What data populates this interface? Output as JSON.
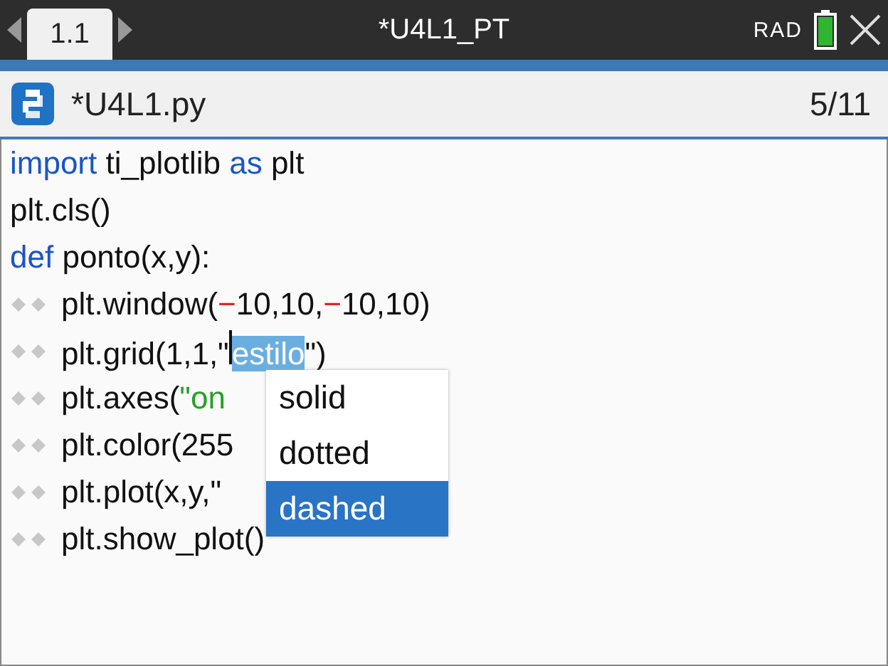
{
  "top_bar": {
    "tab": {
      "label": "1.1",
      "selected": true
    },
    "title": "*U4L1_PT",
    "angle_mode": "RAD"
  },
  "editor": {
    "file_name": "*U4L1.py",
    "position": "5/11",
    "lines": [
      {
        "tokens": [
          {
            "kind": "keyword",
            "text": "import"
          },
          {
            "kind": "plain",
            "text": " ti_plotlib "
          },
          {
            "kind": "keyword",
            "text": "as"
          },
          {
            "kind": "plain",
            "text": " plt"
          }
        ]
      },
      {
        "tokens": [
          {
            "kind": "plain",
            "text": "plt.cls()"
          }
        ]
      },
      {
        "tokens": [
          {
            "kind": "keyword",
            "text": "def"
          },
          {
            "kind": "plain",
            "text": " ponto(x,y):"
          }
        ],
        "children": [
          {
            "tokens": [
              {
                "kind": "plain",
                "text": "plt.window("
              },
              {
                "kind": "operator",
                "text": "−"
              },
              {
                "kind": "plain",
                "text": "10,10,"
              },
              {
                "kind": "operator",
                "text": "−"
              },
              {
                "kind": "plain",
                "text": "10,10)"
              }
            ]
          },
          {
            "tokens": [
              {
                "kind": "plain",
                "text": "plt.grid(1,1,\""
              },
              {
                "kind": "cursor"
              },
              {
                "kind": "selected",
                "text": "estilo"
              },
              {
                "kind": "plain",
                "text": "\")"
              }
            ]
          },
          {
            "tokens": [
              {
                "kind": "plain",
                "text": "plt.axes("
              },
              {
                "kind": "string",
                "text": "\"on"
              }
            ]
          },
          {
            "tokens": [
              {
                "kind": "plain",
                "text": "plt.color(255"
              }
            ]
          },
          {
            "tokens": [
              {
                "kind": "plain",
                "text": "plt.plot(x,y,\""
              }
            ]
          },
          {
            "tokens": [
              {
                "kind": "plain",
                "text": "plt.show_plot()"
              }
            ]
          }
        ]
      }
    ]
  },
  "completion_menu": [
    {
      "label": "solid",
      "selected": false
    },
    {
      "label": "dotted",
      "selected": false
    },
    {
      "label": "dashed",
      "selected": true
    }
  ]
}
